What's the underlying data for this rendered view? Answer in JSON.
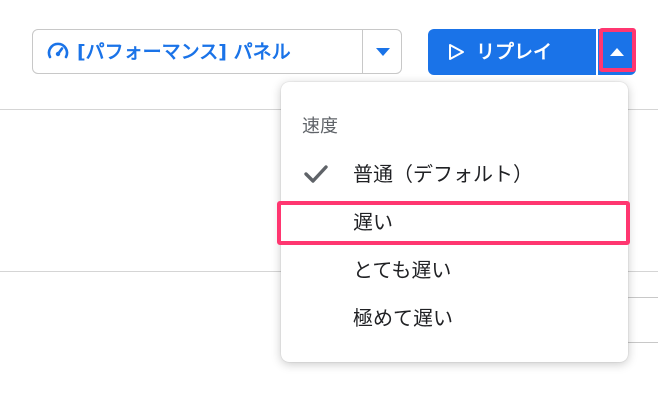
{
  "toolbar": {
    "panel_select": {
      "icon": "gauge-icon",
      "label": "[パフォーマンス] パネル"
    },
    "replay_button": {
      "icon": "play-icon",
      "label": "リプレイ"
    },
    "speed_toggle": {
      "icon": "caret-up-icon"
    }
  },
  "speed_menu": {
    "heading": "速度",
    "items": [
      {
        "label": "普通（デフォルト）",
        "checked": true
      },
      {
        "label": "遅い",
        "checked": false
      },
      {
        "label": "とても遅い",
        "checked": false
      },
      {
        "label": "極めて遅い",
        "checked": false
      }
    ]
  },
  "colors": {
    "accent": "#1a73e8",
    "highlight": "#ff3670"
  }
}
